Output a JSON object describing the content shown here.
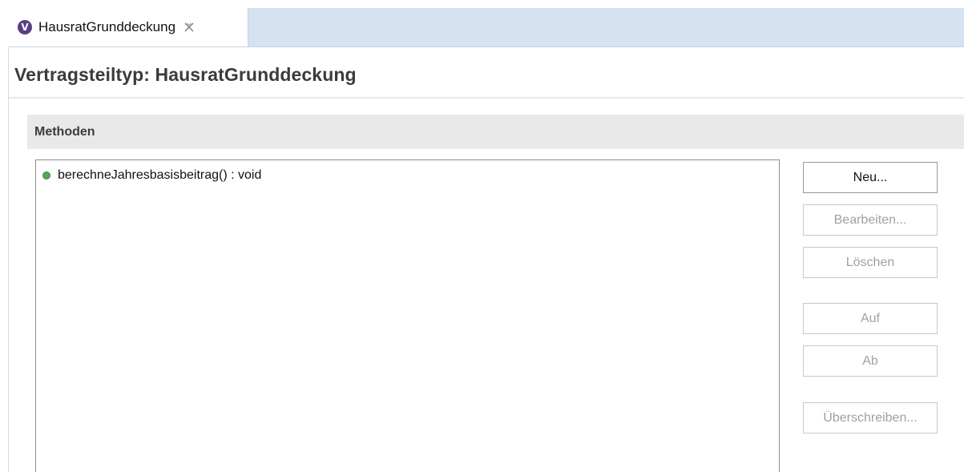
{
  "editor_tab": {
    "icon_letter": "V",
    "label": "HausratGrunddeckung",
    "close_icon": "close-icon"
  },
  "header": {
    "title": "Vertragsteiltyp: HausratGrunddeckung"
  },
  "section": {
    "title": "Methoden"
  },
  "methods": [
    {
      "label": "berechneJahresbasisbeitrag() : void",
      "icon": "method-public-icon"
    }
  ],
  "buttons": {
    "new": "Neu...",
    "edit": "Bearbeiten...",
    "delete": "Löschen",
    "up": "Auf",
    "down": "Ab",
    "override": "Überschreiben..."
  },
  "colors": {
    "tabbar_bg": "#d5e2f2",
    "tab_icon": "#5b3c88",
    "method_icon": "#5aa55a",
    "section_bg": "#e9e9e9"
  }
}
